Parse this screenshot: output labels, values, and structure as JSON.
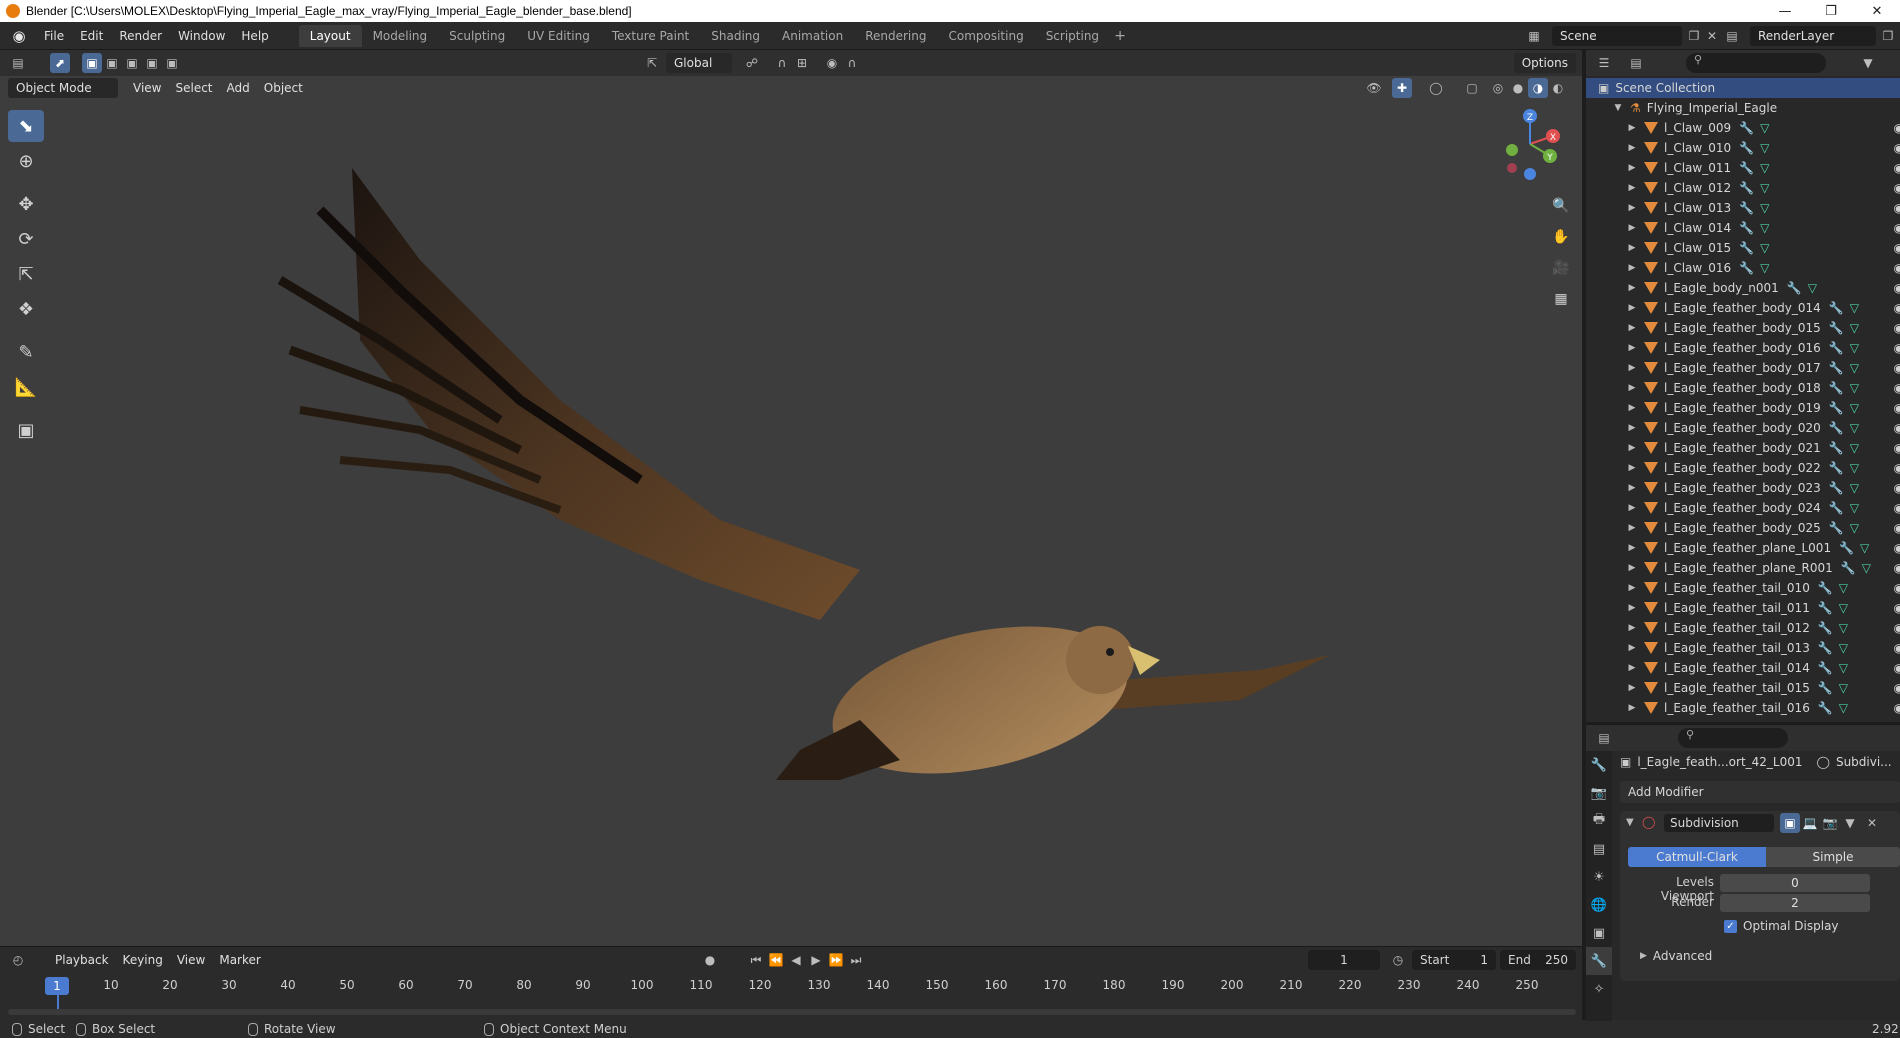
{
  "window": {
    "title": "Blender [C:\\Users\\MOLEX\\Desktop\\Flying_Imperial_Eagle_max_vray/Flying_Imperial_Eagle_blender_base.blend]"
  },
  "menu": [
    "File",
    "Edit",
    "Render",
    "Window",
    "Help"
  ],
  "workspaces": [
    "Layout",
    "Modeling",
    "Sculpting",
    "UV Editing",
    "Texture Paint",
    "Shading",
    "Animation",
    "Rendering",
    "Compositing",
    "Scripting"
  ],
  "active_workspace": "Layout",
  "scene": {
    "name": "Scene",
    "render_layer": "RenderLayer"
  },
  "viewport": {
    "mode": "Object Mode",
    "menus": [
      "View",
      "Select",
      "Add",
      "Object"
    ],
    "transform_orientation": "Global",
    "options_label": "Options",
    "gizmo_axes": [
      "X",
      "Y",
      "Z"
    ]
  },
  "outliner": {
    "root": "Scene Collection",
    "collection": "Flying_Imperial_Eagle",
    "items": [
      "l_Claw_009",
      "l_Claw_010",
      "l_Claw_011",
      "l_Claw_012",
      "l_Claw_013",
      "l_Claw_014",
      "l_Claw_015",
      "l_Claw_016",
      "l_Eagle_body_n001",
      "l_Eagle_feather_body_014",
      "l_Eagle_feather_body_015",
      "l_Eagle_feather_body_016",
      "l_Eagle_feather_body_017",
      "l_Eagle_feather_body_018",
      "l_Eagle_feather_body_019",
      "l_Eagle_feather_body_020",
      "l_Eagle_feather_body_021",
      "l_Eagle_feather_body_022",
      "l_Eagle_feather_body_023",
      "l_Eagle_feather_body_024",
      "l_Eagle_feather_body_025",
      "l_Eagle_feather_plane_L001",
      "l_Eagle_feather_plane_R001",
      "l_Eagle_feather_tail_010",
      "l_Eagle_feather_tail_011",
      "l_Eagle_feather_tail_012",
      "l_Eagle_feather_tail_013",
      "l_Eagle_feather_tail_014",
      "l_Eagle_feather_tail_015",
      "l_Eagle_feather_tail_016"
    ]
  },
  "properties": {
    "object_name": "l_Eagle_feath...ort_42_L001",
    "modifier_short": "Subdivi...",
    "add_modifier": "Add Modifier",
    "modifier": {
      "name": "Subdivision",
      "type_options": [
        "Catmull-Clark",
        "Simple"
      ],
      "selected_type": "Catmull-Clark",
      "levels_viewport_label": "Levels Viewport",
      "levels_viewport": "0",
      "render_label": "Render",
      "render": "2",
      "optimal_display_label": "Optimal Display",
      "optimal_display": true,
      "advanced_label": "Advanced"
    }
  },
  "timeline": {
    "menus": [
      "Playback",
      "Keying",
      "View",
      "Marker"
    ],
    "current_frame": "1",
    "start_label": "Start",
    "start": "1",
    "end_label": "End",
    "end": "250",
    "ruler_current": "1",
    "ruler_ticks": [
      "10",
      "20",
      "30",
      "40",
      "50",
      "60",
      "70",
      "80",
      "90",
      "100",
      "110",
      "120",
      "130",
      "140",
      "150",
      "160",
      "170",
      "180",
      "190",
      "200",
      "210",
      "220",
      "230",
      "240",
      "250"
    ]
  },
  "statusbar": {
    "select": "Select",
    "box_select": "Box Select",
    "rotate_view": "Rotate View",
    "context_menu": "Object Context Menu",
    "version": "2.92"
  },
  "colors": {
    "accent_blue": "#4a7bd0",
    "selection_blue": "#334d80",
    "mesh_orange": "#e38b3c",
    "mesh_green": "#4fd1a3",
    "wrench_blue": "#6aa9e8"
  }
}
